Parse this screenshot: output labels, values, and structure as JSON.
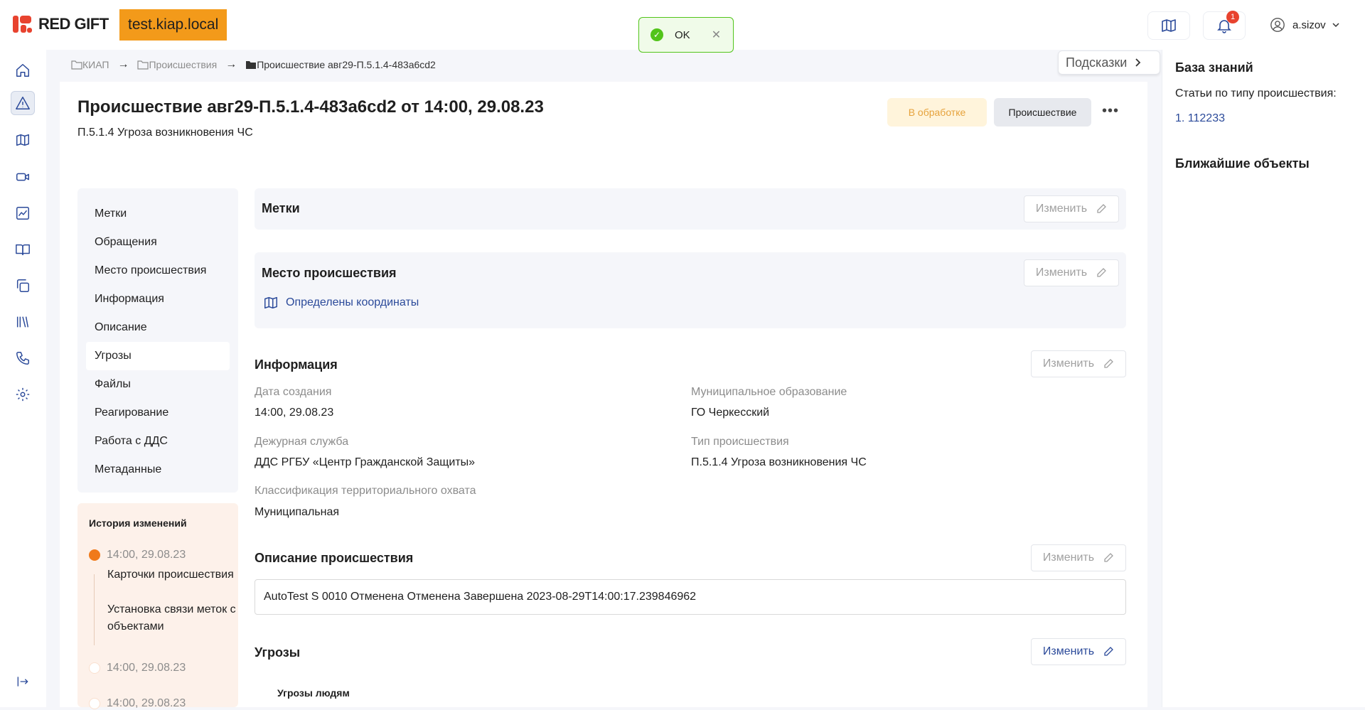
{
  "header": {
    "brand": "RED GIFT",
    "host": "test.kiap.local",
    "toast_text": "OK",
    "notification_count": "1",
    "user_name": "a.sizov"
  },
  "breadcrumb": {
    "items": [
      "КИАП",
      "Происшествия",
      "Происшествие авг29-П.5.1.4-483a6cd2"
    ]
  },
  "hints_button": "Подсказки",
  "incident": {
    "title": "Происшествие авг29-П.5.1.4-483a6cd2 от 14:00, 29.08.23",
    "subtitle": "П.5.1.4 Угроза возникновения ЧС",
    "status": "В обработке",
    "type": "Происшествие"
  },
  "side_nav": {
    "items": [
      "Метки",
      "Обращения",
      "Место происшествия",
      "Информация",
      "Описание",
      "Угрозы",
      "Файлы",
      "Реагирование",
      "Работа с ДДС",
      "Метаданные"
    ]
  },
  "history": {
    "title": "История изменений",
    "entries": [
      {
        "time": "14:00, 29.08.23",
        "details": [
          "Карточки происшествия",
          "Установка связи меток с объектами"
        ]
      },
      {
        "time": "14:00, 29.08.23"
      },
      {
        "time": "14:00, 29.08.23"
      }
    ]
  },
  "sections": {
    "edit_label": "Изменить",
    "tags_title": "Метки",
    "place_title": "Место происшествия",
    "coords_link": "Определены координаты",
    "info_title": "Информация",
    "info": {
      "created_label": "Дата создания",
      "created_value": "14:00, 29.08.23",
      "municipality_label": "Муниципальное образование",
      "municipality_value": "ГО Черкесский",
      "duty_label": "Дежурная служба",
      "duty_value": "ДДС РГБУ «Центр Гражданской Защиты»",
      "type_label": "Тип происшествия",
      "type_value": "П.5.1.4 Угроза возникновения ЧС",
      "coverage_label": "Классификация территориального охвата",
      "coverage_value": "Муниципальная"
    },
    "description_title": "Описание происшествия",
    "description_value": "AutoTest S 0010 Отменена Отменена Завершена 2023-08-29T14:00:17.239846962",
    "threats_title": "Угрозы",
    "threats_sub": "Угрозы людям"
  },
  "right_panel": {
    "title": "База знаний",
    "articles_label": "Статьи по типу происшествия:",
    "article_link": "1. 112233",
    "nearby_title": "Ближайшие объекты"
  }
}
